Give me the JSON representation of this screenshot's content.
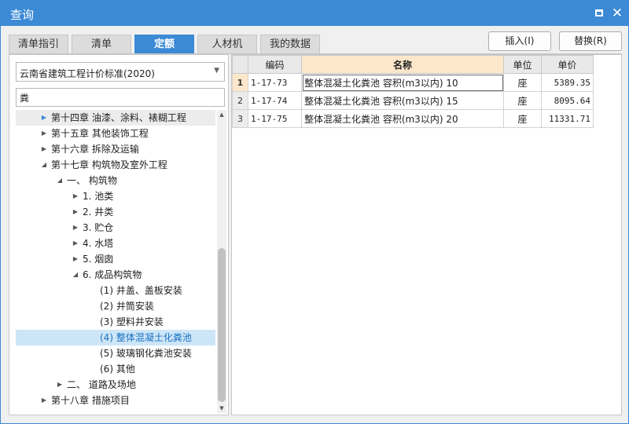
{
  "window": {
    "title": "查询",
    "maximize_label": "",
    "close_label": "✕"
  },
  "tabs": [
    {
      "label": "清单指引",
      "active": false
    },
    {
      "label": "清单",
      "active": false
    },
    {
      "label": "定额",
      "active": true
    },
    {
      "label": "人材机",
      "active": false
    },
    {
      "label": "我的数据",
      "active": false
    }
  ],
  "toolbar": {
    "insert_label": "插入(I)",
    "replace_label": "替换(R)"
  },
  "left": {
    "standard_select": "云南省建筑工程计价标准(2020)",
    "search_value": "粪"
  },
  "tree": [
    {
      "label": "第十四章 油漆、涂料、裱糊工程",
      "level": 0,
      "toggle": "collapsed",
      "state": "first"
    },
    {
      "label": "第十五章 其他装饰工程",
      "level": 0,
      "toggle": "collapsed",
      "state": ""
    },
    {
      "label": "第十六章 拆除及运输",
      "level": 0,
      "toggle": "collapsed",
      "state": ""
    },
    {
      "label": "第十七章 构筑物及室外工程",
      "level": 0,
      "toggle": "expanded",
      "state": ""
    },
    {
      "label": "一、 构筑物",
      "level": 1,
      "toggle": "expanded",
      "state": ""
    },
    {
      "label": "1. 池类",
      "level": 2,
      "toggle": "collapsed",
      "state": ""
    },
    {
      "label": "2. 井类",
      "level": 2,
      "toggle": "collapsed",
      "state": ""
    },
    {
      "label": "3. 贮仓",
      "level": 2,
      "toggle": "collapsed",
      "state": ""
    },
    {
      "label": "4. 水塔",
      "level": 2,
      "toggle": "collapsed",
      "state": ""
    },
    {
      "label": "5. 烟囱",
      "level": 2,
      "toggle": "collapsed",
      "state": ""
    },
    {
      "label": "6. 成品构筑物",
      "level": 2,
      "toggle": "expanded",
      "state": ""
    },
    {
      "label": "(1) 井盖、盖板安装",
      "level": 3,
      "toggle": "none",
      "state": ""
    },
    {
      "label": "(2) 井筒安装",
      "level": 3,
      "toggle": "none",
      "state": ""
    },
    {
      "label": "(3) 塑料井安装",
      "level": 3,
      "toggle": "none",
      "state": ""
    },
    {
      "label": "(4) 整体混凝土化粪池",
      "level": 3,
      "toggle": "none",
      "state": "selected"
    },
    {
      "label": "(5) 玻璃钢化粪池安装",
      "level": 3,
      "toggle": "none",
      "state": ""
    },
    {
      "label": "(6) 其他",
      "level": 3,
      "toggle": "none",
      "state": ""
    },
    {
      "label": "二、 道路及场地",
      "level": 1,
      "toggle": "collapsed",
      "state": ""
    },
    {
      "label": "第十八章 措施项目",
      "level": 0,
      "toggle": "collapsed",
      "state": ""
    }
  ],
  "grid": {
    "headers": [
      "",
      "编码",
      "名称",
      "单位",
      "单价"
    ],
    "rows": [
      {
        "num": "1",
        "code": "1-17-73",
        "name": "整体混凝土化粪池 容积(m3以内) 10",
        "unit": "座",
        "price": "5389.35"
      },
      {
        "num": "2",
        "code": "1-17-74",
        "name": "整体混凝土化粪池 容积(m3以内) 15",
        "unit": "座",
        "price": "8095.64"
      },
      {
        "num": "3",
        "code": "1-17-75",
        "name": "整体混凝土化粪池 容积(m3以内) 20",
        "unit": "座",
        "price": "11331.71"
      }
    ]
  },
  "colors": {
    "accent": "#3c8ad6",
    "selected_row": "#cde6f7",
    "header_highlight": "#fde7cb"
  }
}
